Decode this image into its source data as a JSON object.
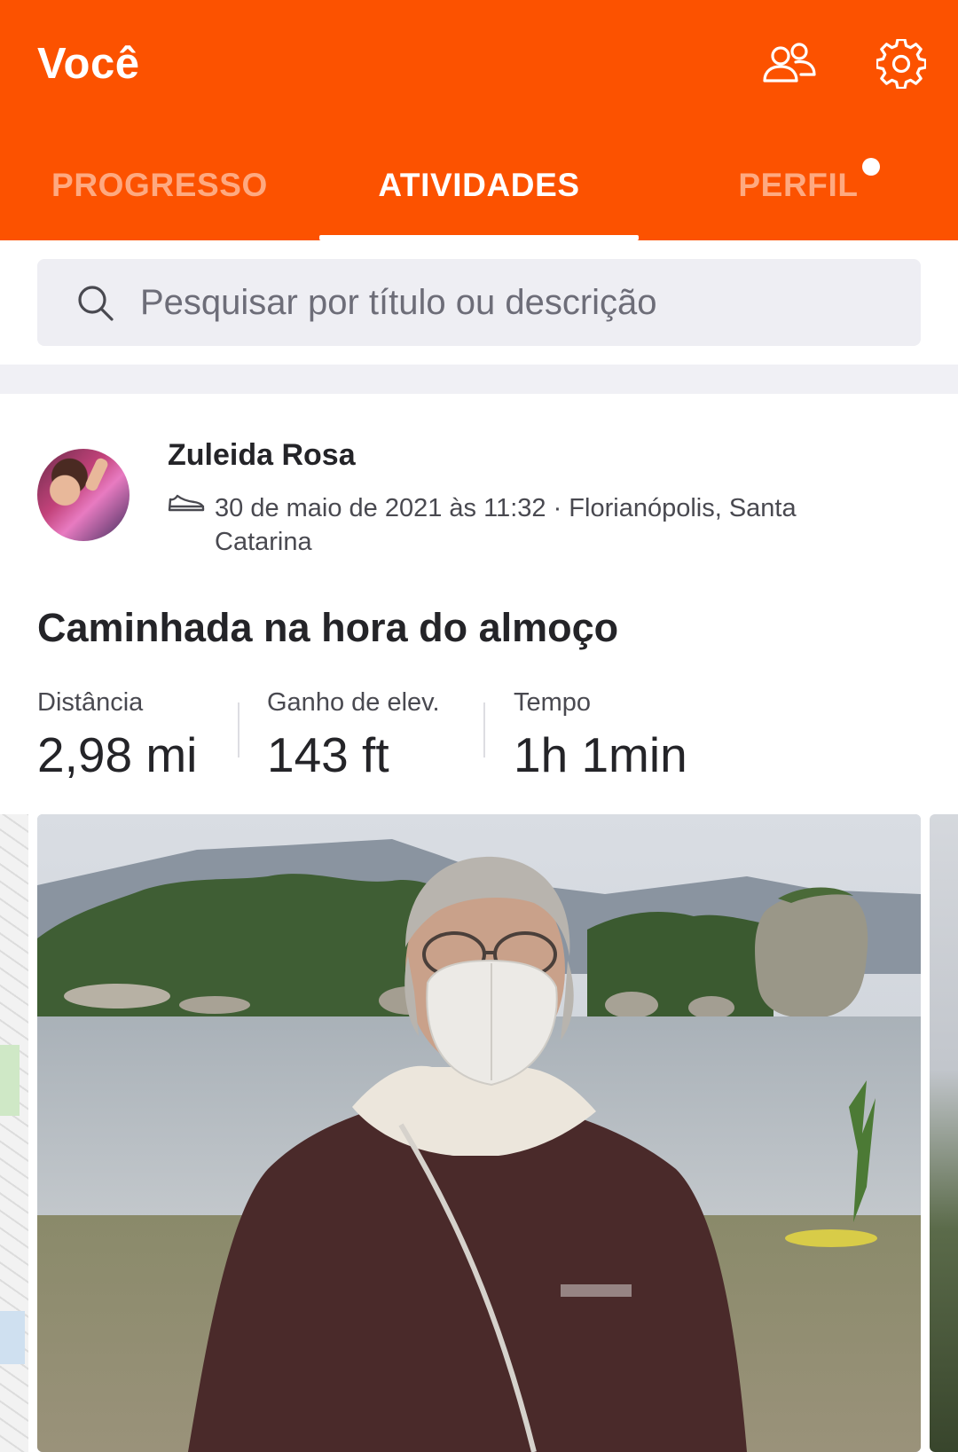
{
  "header": {
    "title": "Você",
    "icons": [
      "people-icon",
      "gear-icon"
    ]
  },
  "tabs": [
    {
      "label": "PROGRESSO",
      "active": false
    },
    {
      "label": "ATIVIDADES",
      "active": true
    },
    {
      "label": "PERFIL",
      "active": false,
      "has_notification_dot": true
    }
  ],
  "search": {
    "placeholder": "Pesquisar por título ou descrição",
    "value": ""
  },
  "activity": {
    "athlete_name": "Zuleida Rosa",
    "sport_icon": "shoe-icon",
    "meta": "30 de maio de 2021 às 11:32 · Florianópolis, Santa Catarina",
    "title": "Caminhada na hora do almoço",
    "stats": [
      {
        "label": "Distância",
        "value": "2,98 mi"
      },
      {
        "label": "Ganho de elev.",
        "value": "143 ft"
      },
      {
        "label": "Tempo",
        "value": "1h 1min"
      }
    ]
  },
  "colors": {
    "brand": "#fc5200",
    "text_primary": "#242428",
    "text_secondary": "#494950",
    "search_bg": "#eeeef3"
  }
}
